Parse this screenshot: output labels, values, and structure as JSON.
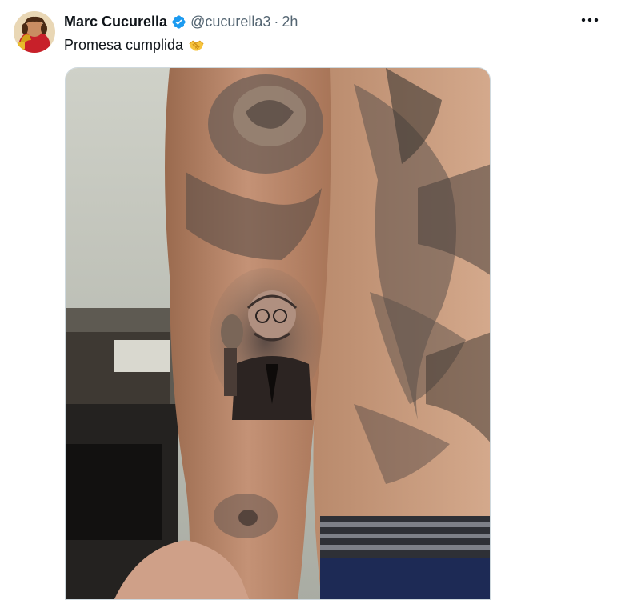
{
  "tweet": {
    "author": {
      "display_name": "Marc Cucurella",
      "handle": "@cucurella3",
      "verified": true,
      "avatar_icon": "profile-photo"
    },
    "separator": "·",
    "time": "2h",
    "text": "Promesa cumplida",
    "emoji_icon": "handshake-emoji",
    "more_icon": "more-horizontal-icon",
    "media": {
      "type": "photo",
      "alt": ""
    }
  },
  "colors": {
    "primary_text": "#0f1419",
    "secondary_text": "#536471",
    "verified_blue": "#1d9bf0",
    "border": "#cfd9de"
  }
}
